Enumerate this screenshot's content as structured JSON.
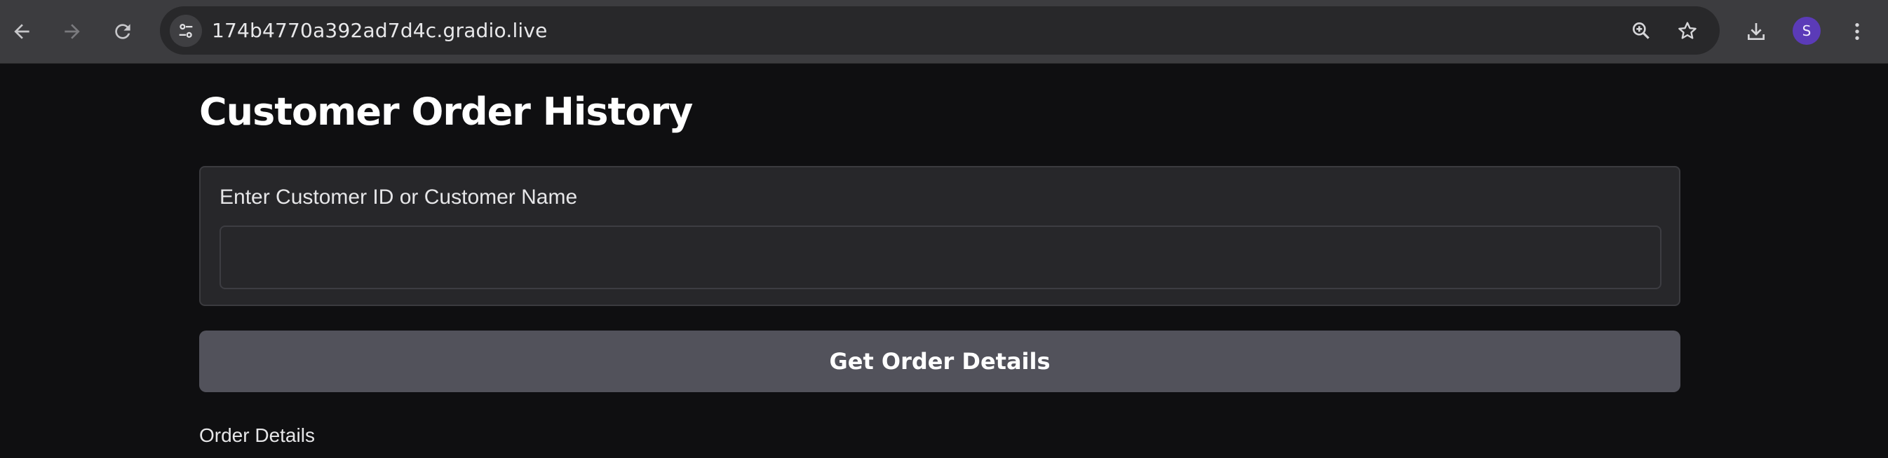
{
  "browser": {
    "url": "174b4770a392ad7d4c.gradio.live",
    "profile_initial": "S",
    "icons": {
      "back": "back-arrow-icon",
      "forward": "forward-arrow-icon",
      "reload": "reload-icon",
      "site_info": "tune-icon",
      "zoom": "zoom-in-icon",
      "bookmark": "star-icon",
      "download": "download-icon",
      "menu": "kebab-menu-icon"
    },
    "colors": {
      "avatar": "#5b3bb8"
    }
  },
  "page": {
    "title": "Customer Order History",
    "input": {
      "label": "Enter Customer ID or Customer Name",
      "value": "",
      "placeholder": ""
    },
    "button_label": "Get Order Details",
    "output_label": "Order Details"
  }
}
